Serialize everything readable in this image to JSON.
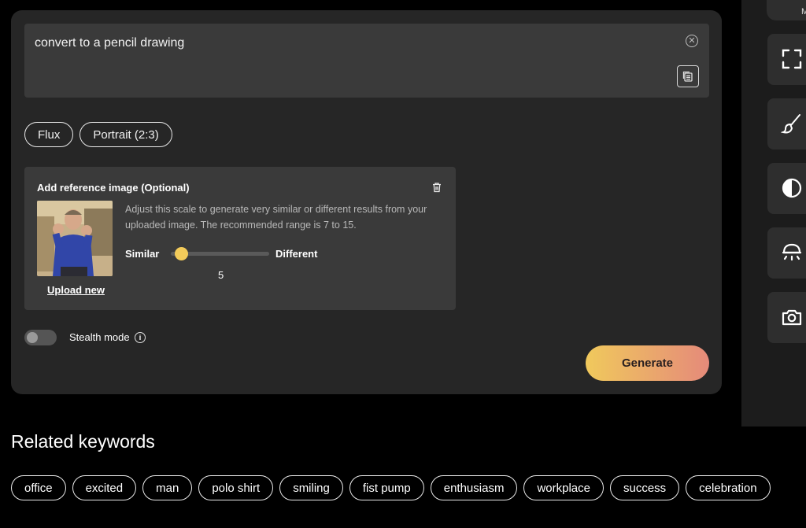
{
  "prompt": {
    "text": "convert to a pencil drawing"
  },
  "options": {
    "chips": [
      "Flux",
      "Portrait (2:3)"
    ]
  },
  "reference": {
    "title": "Add reference image (Optional)",
    "description": "Adjust this scale to generate very similar or different results from your uploaded image. The recommended range is 7 to 15.",
    "similar_label": "Similar",
    "different_label": "Different",
    "slider_value": "5",
    "upload_label": "Upload new"
  },
  "stealth": {
    "label": "Stealth mode",
    "enabled": false
  },
  "generate_label": "Generate",
  "rail": {
    "top_label": "M",
    "icons": [
      "expand-icon",
      "brush-icon",
      "contrast-icon",
      "lamp-icon",
      "camera-icon"
    ]
  },
  "related": {
    "title": "Related keywords",
    "keywords": [
      "office",
      "excited",
      "man",
      "polo shirt",
      "smiling",
      "fist pump",
      "enthusiasm",
      "workplace",
      "success",
      "celebration"
    ]
  },
  "colors": {
    "accent_start": "#f0c95c",
    "accent_end": "#e58a7a",
    "panel": "#262626"
  }
}
